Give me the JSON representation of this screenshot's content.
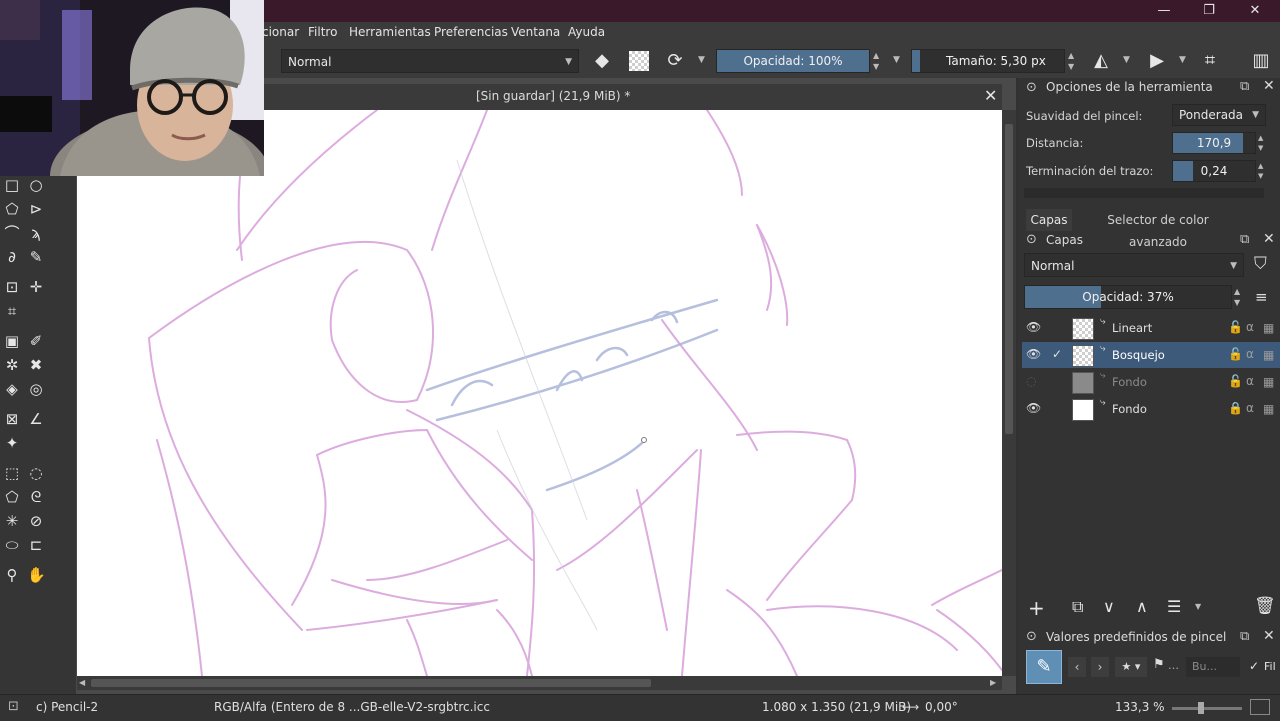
{
  "menu": [
    "cionar",
    "Filtro",
    "Herramientas",
    "Preferencias",
    "Ventana",
    "Ayuda"
  ],
  "window_controls": {
    "minimize": "—",
    "maximize": "❐",
    "close": "✕"
  },
  "toolbar": {
    "blend_mode": "Normal",
    "opacity_label": "Opacidad: 100%",
    "opacity_fraction": 1.0,
    "size_label": "Tamaño: 5,30 px",
    "size_fraction": 0.05
  },
  "document": {
    "title": "[Sin guardar]  (21,9 MiB) *"
  },
  "tool_options": {
    "title": "Opciones de la herramienta",
    "smoothing_label": "Suavidad del pincel:",
    "smoothing_value": "Ponderada",
    "distance_label": "Distancia:",
    "distance_value": "170,9",
    "distance_fraction": 0.85,
    "finish_label": "Terminación del trazo:",
    "finish_value": "0,24",
    "finish_fraction": 0.24
  },
  "docker_tabs": [
    "Capas",
    "Selector de color avanzado"
  ],
  "layers": {
    "title": "Capas",
    "blend_mode": "Normal",
    "opacity_label": "Opacidad:  37%",
    "opacity_fraction": 0.37,
    "items": [
      {
        "name": "Lineart",
        "visible": true,
        "selected": false,
        "thumb": "checker",
        "locked": false
      },
      {
        "name": "Bosquejo",
        "visible": true,
        "selected": true,
        "thumb": "checker",
        "locked": false
      },
      {
        "name": "Fondo",
        "visible": false,
        "selected": false,
        "thumb": "gray",
        "locked": false
      },
      {
        "name": "Fondo",
        "visible": true,
        "selected": false,
        "thumb": "white",
        "locked": true
      }
    ]
  },
  "presets": {
    "title": "Valores predefinidos de pincel",
    "search_placeholder": "Bu...",
    "filter_label": "Fil"
  },
  "status": {
    "brush": "c) Pencil-2",
    "color_profile": "RGB/Alfa (Entero de 8 ...GB-elle-V2-srgbtrc.icc",
    "dimensions": "1.080 x 1.350 (21,9 MiB)",
    "rotation": "0,00°",
    "zoom": "133,3 %"
  },
  "colors": {
    "accent": "#4f6f8f",
    "selected_row": "#3d5a7a",
    "sketch_pink": "#d9a6dd",
    "sketch_blue": "#a9b4d6"
  }
}
